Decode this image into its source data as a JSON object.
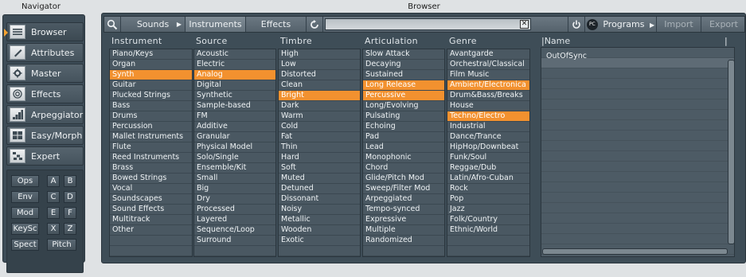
{
  "navigator": {
    "title": "Navigator",
    "buttons": [
      {
        "label": "Browser",
        "icon": "list-icon"
      },
      {
        "label": "Attributes",
        "icon": "edit-icon"
      },
      {
        "label": "Master",
        "icon": "gear-icon"
      },
      {
        "label": "Effects",
        "icon": "circle-target-icon"
      },
      {
        "label": "Arpeggiator",
        "icon": "staircase-icon"
      },
      {
        "label": "Easy/Morph",
        "icon": "grid-icon"
      },
      {
        "label": "Expert",
        "icon": "blocks-icon"
      }
    ],
    "active": "Browser",
    "mini": [
      "Ops",
      "A",
      "B",
      "Env",
      "C",
      "D",
      "Mod",
      "E",
      "F",
      "KeySc",
      "X",
      "Z",
      "Spect",
      "Pitch"
    ]
  },
  "browser": {
    "title": "Browser",
    "toolbar": {
      "sounds": "Sounds",
      "instruments": "Instruments",
      "effects": "Effects",
      "clear": "☒",
      "programs": "Programs",
      "import": "Import",
      "export": "Export",
      "pc_badge": "PC"
    },
    "columns": [
      {
        "title": "Instrument",
        "items": [
          "Piano/Keys",
          "Organ",
          "Synth",
          "Guitar",
          "Plucked Strings",
          "Bass",
          "Drums",
          "Percussion",
          "Mallet Instruments",
          "Flute",
          "Reed Instruments",
          "Brass",
          "Bowed Strings",
          "Vocal",
          "Soundscapes",
          "Sound Effects",
          "Multitrack",
          "Other"
        ],
        "selected": [
          "Synth"
        ]
      },
      {
        "title": "Source",
        "items": [
          "Acoustic",
          "Electric",
          "Analog",
          "Digital",
          "Synthetic",
          "Sample-based",
          "FM",
          "Additive",
          "Granular",
          "Physical Model",
          "Solo/Single",
          "Ensemble/Kit",
          "Small",
          "Big",
          "Dry",
          "Processed",
          "Layered",
          "Sequence/Loop",
          "Surround"
        ],
        "selected": [
          "Analog"
        ]
      },
      {
        "title": "Timbre",
        "items": [
          "High",
          "Low",
          "Distorted",
          "Clean",
          "Bright",
          "Dark",
          "Warm",
          "Cold",
          "Fat",
          "Thin",
          "Hard",
          "Soft",
          "Muted",
          "Detuned",
          "Dissonant",
          "Noisy",
          "Metallic",
          "Wooden",
          "Exotic"
        ],
        "selected": [
          "Bright"
        ]
      },
      {
        "title": "Articulation",
        "items": [
          "Slow Attack",
          "Decaying",
          "Sustained",
          "Long Release",
          "Percussive",
          "Long/Evolving",
          "Pulsating",
          "Echoing",
          "Pad",
          "Lead",
          "Monophonic",
          "Chord",
          "Glide/Pitch Mod",
          "Sweep/Filter Mod",
          "Arpeggiated",
          "Tempo-synced",
          "Expressive",
          "Multiple",
          "Randomized"
        ],
        "selected": [
          "Long Release",
          "Percussive"
        ]
      },
      {
        "title": "Genre",
        "items": [
          "Avantgarde",
          "Orchestral/Classical",
          "Film Music",
          "Ambient/Electronica",
          "Drum&Bass/Breaks",
          "House",
          "Techno/Electro",
          "Industrial",
          "Dance/Trance",
          "HipHop/Downbeat",
          "Funk/Soul",
          "Reggae/Dub",
          "Latin/Afro-Cuban",
          "Rock",
          "Pop",
          "Jazz",
          "Folk/Country",
          "Ethnic/World"
        ],
        "selected": [
          "Ambient/Electronica",
          "Techno/Electro"
        ]
      }
    ],
    "results": {
      "name_header": "|Name",
      "extra_header": "|",
      "items": [
        "OutOfSync"
      ]
    }
  }
}
